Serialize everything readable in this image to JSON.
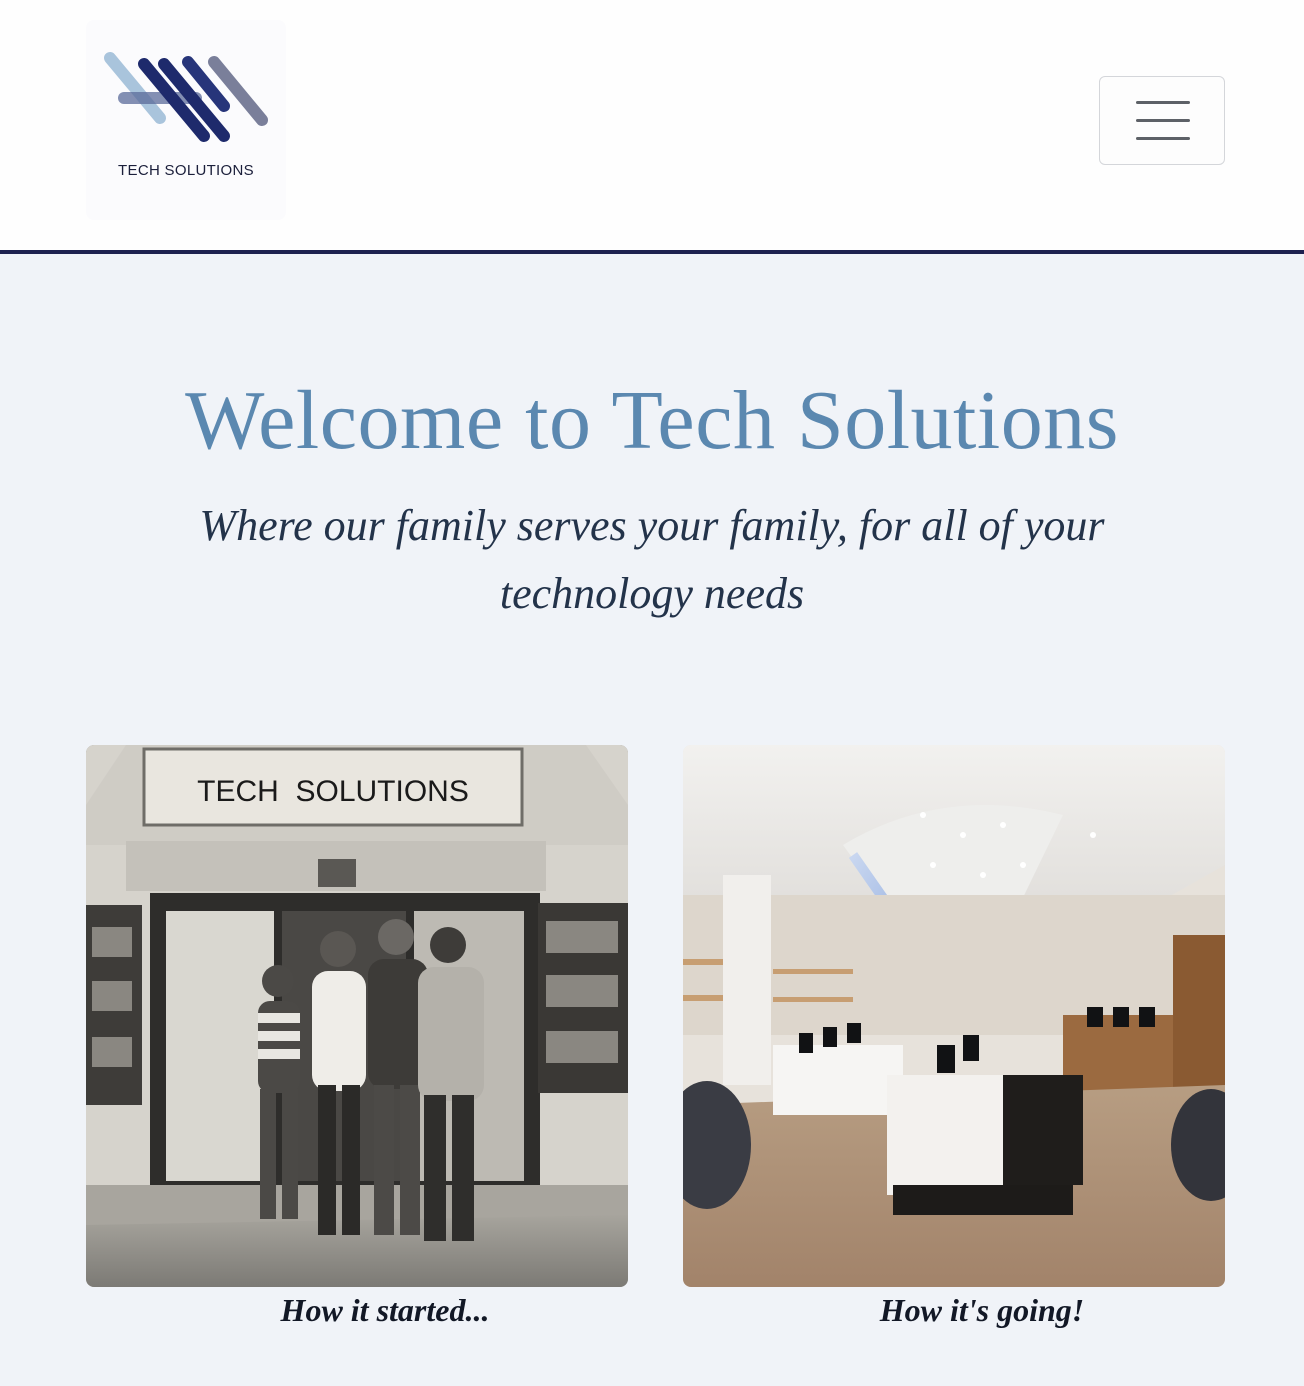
{
  "header": {
    "logo_text": "TECH SOLUTIONS",
    "menu_icon": "hamburger-menu-icon",
    "border_color": "#1d2150"
  },
  "hero": {
    "title": "Welcome to Tech Solutions",
    "subtitle": "Where our family serves your family, for all of your technology needs",
    "title_color": "#5b88b0"
  },
  "gallery": {
    "items": [
      {
        "caption": "How it started...",
        "sign_text": "TECH  SOLUTIONS",
        "style": "black-and-white"
      },
      {
        "caption": "How it's going!",
        "style": "color"
      }
    ]
  }
}
